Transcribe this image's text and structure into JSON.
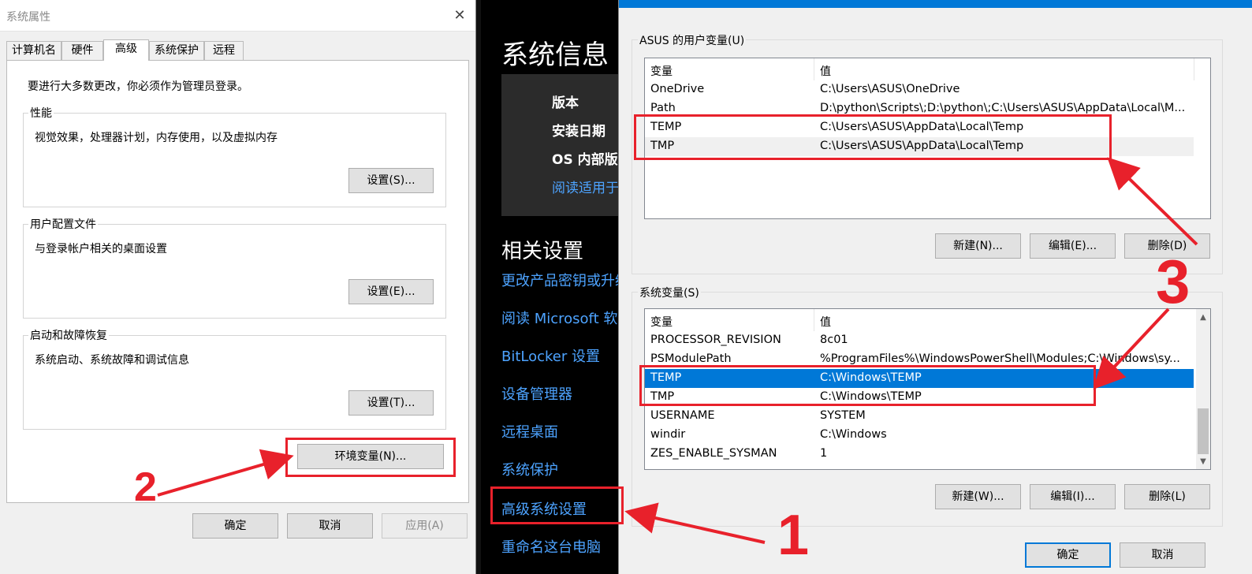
{
  "system_properties": {
    "title": "系统属性",
    "close_glyph": "✕",
    "tabs": [
      "计算机名",
      "硬件",
      "高级",
      "系统保护",
      "远程"
    ],
    "selected_tab": "高级",
    "admin_note": "要进行大多数更改，你必须作为管理员登录。",
    "groups": {
      "performance": {
        "label": "性能",
        "description": "视觉效果，处理器计划，内存使用，以及虚拟内存",
        "button": "设置(S)..."
      },
      "user_profiles": {
        "label": "用户配置文件",
        "description": "与登录帐户相关的桌面设置",
        "button": "设置(E)..."
      },
      "startup_recovery": {
        "label": "启动和故障恢复",
        "description": "系统启动、系统故障和调试信息",
        "button": "设置(T)..."
      }
    },
    "env_button": "环境变量(N)...",
    "footer": {
      "ok": "确定",
      "cancel": "取消",
      "apply": "应用(A)"
    }
  },
  "settings_page": {
    "title": "系统信息",
    "spec_labels": [
      "版本",
      "安装日期",
      "OS 内部版本"
    ],
    "spec_link": "阅读适用于",
    "related_title": "相关设置",
    "links": [
      "更改产品密钥或升级",
      "阅读 Microsoft 软件",
      "BitLocker 设置",
      "设备管理器",
      "远程桌面",
      "系统保护",
      "高级系统设置",
      "重命名这台电脑"
    ]
  },
  "environment_variables": {
    "user_section_label": "ASUS 的用户变量(U)",
    "columns": {
      "variable": "变量",
      "value": "值"
    },
    "user_vars": [
      {
        "name": "OneDrive",
        "value": "C:\\Users\\ASUS\\OneDrive"
      },
      {
        "name": "Path",
        "value": "D:\\python\\Scripts\\;D:\\python\\;C:\\Users\\ASUS\\AppData\\Local\\M..."
      },
      {
        "name": "TEMP",
        "value": "C:\\Users\\ASUS\\AppData\\Local\\Temp"
      },
      {
        "name": "TMP",
        "value": "C:\\Users\\ASUS\\AppData\\Local\\Temp"
      }
    ],
    "user_buttons": {
      "new": "新建(N)...",
      "edit": "编辑(E)...",
      "delete": "删除(D)"
    },
    "system_section_label": "系统变量(S)",
    "system_vars": [
      {
        "name": "PROCESSOR_REVISION",
        "value": "8c01"
      },
      {
        "name": "PSModulePath",
        "value": "%ProgramFiles%\\WindowsPowerShell\\Modules;C:\\Windows\\sy..."
      },
      {
        "name": "TEMP",
        "value": "C:\\Windows\\TEMP"
      },
      {
        "name": "TMP",
        "value": "C:\\Windows\\TEMP"
      },
      {
        "name": "USERNAME",
        "value": "SYSTEM"
      },
      {
        "name": "windir",
        "value": "C:\\Windows"
      },
      {
        "name": "ZES_ENABLE_SYSMAN",
        "value": "1"
      }
    ],
    "system_selected_row": 2,
    "system_buttons": {
      "new": "新建(W)...",
      "edit": "编辑(I)...",
      "delete": "删除(L)"
    },
    "footer": {
      "ok": "确定",
      "cancel": "取消"
    }
  },
  "annotations": {
    "step1": "1",
    "step2": "2",
    "step3": "3",
    "color": "#e8212b"
  }
}
